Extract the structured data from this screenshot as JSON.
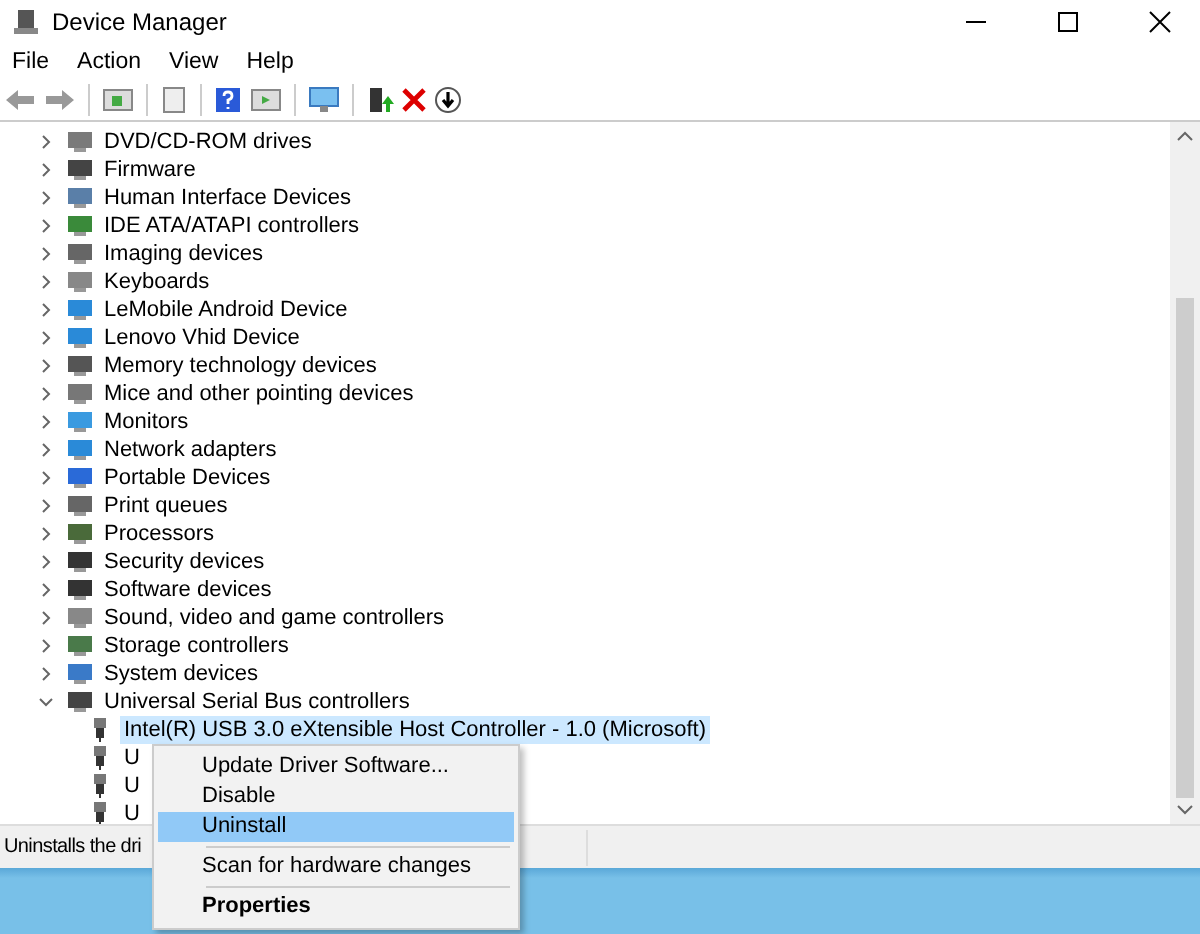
{
  "window": {
    "title": "Device Manager"
  },
  "menu_bar": [
    "File",
    "Action",
    "View",
    "Help"
  ],
  "tree": [
    {
      "label": "DVD/CD-ROM drives",
      "expanded": false
    },
    {
      "label": "Firmware",
      "expanded": false
    },
    {
      "label": "Human Interface Devices",
      "expanded": false
    },
    {
      "label": "IDE ATA/ATAPI controllers",
      "expanded": false
    },
    {
      "label": "Imaging devices",
      "expanded": false
    },
    {
      "label": "Keyboards",
      "expanded": false
    },
    {
      "label": "LeMobile Android Device",
      "expanded": false
    },
    {
      "label": "Lenovo Vhid Device",
      "expanded": false
    },
    {
      "label": "Memory technology devices",
      "expanded": false
    },
    {
      "label": "Mice and other pointing devices",
      "expanded": false
    },
    {
      "label": "Monitors",
      "expanded": false
    },
    {
      "label": "Network adapters",
      "expanded": false
    },
    {
      "label": "Portable Devices",
      "expanded": false
    },
    {
      "label": "Print queues",
      "expanded": false
    },
    {
      "label": "Processors",
      "expanded": false
    },
    {
      "label": "Security devices",
      "expanded": false
    },
    {
      "label": "Software devices",
      "expanded": false
    },
    {
      "label": "Sound, video and game controllers",
      "expanded": false
    },
    {
      "label": "Storage controllers",
      "expanded": false
    },
    {
      "label": "System devices",
      "expanded": false
    },
    {
      "label": "Universal Serial Bus controllers",
      "expanded": true,
      "children": [
        {
          "label": "Intel(R) USB 3.0 eXtensible Host Controller - 1.0 (Microsoft)",
          "selected": true
        },
        {
          "label": "U",
          "selected": false
        },
        {
          "label": "U",
          "selected": false
        },
        {
          "label": "U",
          "selected": false
        }
      ]
    }
  ],
  "context_menu": [
    {
      "label": "Update Driver Software...",
      "kind": "item",
      "selected": false
    },
    {
      "label": "Disable",
      "kind": "item",
      "selected": false
    },
    {
      "label": "Uninstall",
      "kind": "item",
      "selected": true
    },
    {
      "kind": "separator"
    },
    {
      "label": "Scan for hardware changes",
      "kind": "item",
      "selected": false
    },
    {
      "kind": "separator"
    },
    {
      "label": "Properties",
      "kind": "default",
      "selected": false
    }
  ],
  "status_bar": {
    "text": "Uninstalls the dri"
  }
}
